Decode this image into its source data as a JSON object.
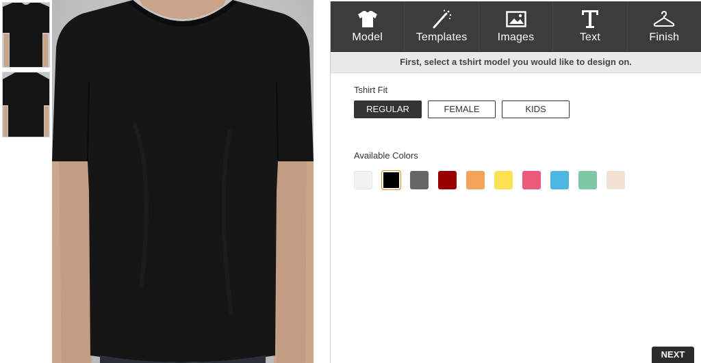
{
  "thumbnails": [
    {
      "view": "front"
    },
    {
      "view": "back"
    }
  ],
  "toolbar": {
    "items": [
      {
        "label": "Model",
        "icon": "tshirt-icon"
      },
      {
        "label": "Templates",
        "icon": "magic-wand-icon"
      },
      {
        "label": "Images",
        "icon": "image-icon"
      },
      {
        "label": "Text",
        "icon": "text-icon"
      },
      {
        "label": "Finish",
        "icon": "hanger-icon"
      }
    ]
  },
  "instruction": "First, select a tshirt model you would like to design on.",
  "fit": {
    "title": "Tshirt Fit",
    "options": [
      "REGULAR",
      "FEMALE",
      "KIDS"
    ],
    "selected": "REGULAR"
  },
  "colors": {
    "title": "Available Colors",
    "swatches": [
      "#f2f2f2",
      "#000000",
      "#666666",
      "#990000",
      "#f3a45a",
      "#fde352",
      "#ec5a79",
      "#4cb6e3",
      "#80c7a7",
      "#f3e1d1"
    ],
    "selected_index": 1
  },
  "next_label": "NEXT",
  "shirt_color": "#161616"
}
